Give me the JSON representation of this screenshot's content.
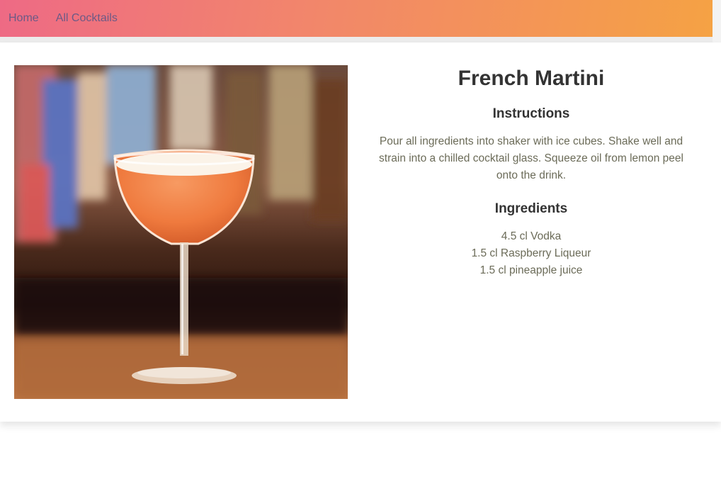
{
  "nav": {
    "home": "Home",
    "all_cocktails": "All Cocktails"
  },
  "cocktail": {
    "name": "French Martini",
    "instructions_heading": "Instructions",
    "instructions": "Pour all ingredients into shaker with ice cubes. Shake well and strain into a chilled cocktail glass. Squeeze oil from lemon peel onto the drink.",
    "ingredients_heading": "Ingredients",
    "ingredients": [
      "4.5 cl Vodka",
      "1.5 cl Raspberry Liqueur",
      "1.5 cl pineapple juice"
    ]
  },
  "colors": {
    "nav_gradient_start": "#ee6a85",
    "nav_gradient_end": "#f5a244",
    "nav_link": "#6c5a86",
    "heading": "#333333",
    "body_text": "#6b6b58"
  }
}
